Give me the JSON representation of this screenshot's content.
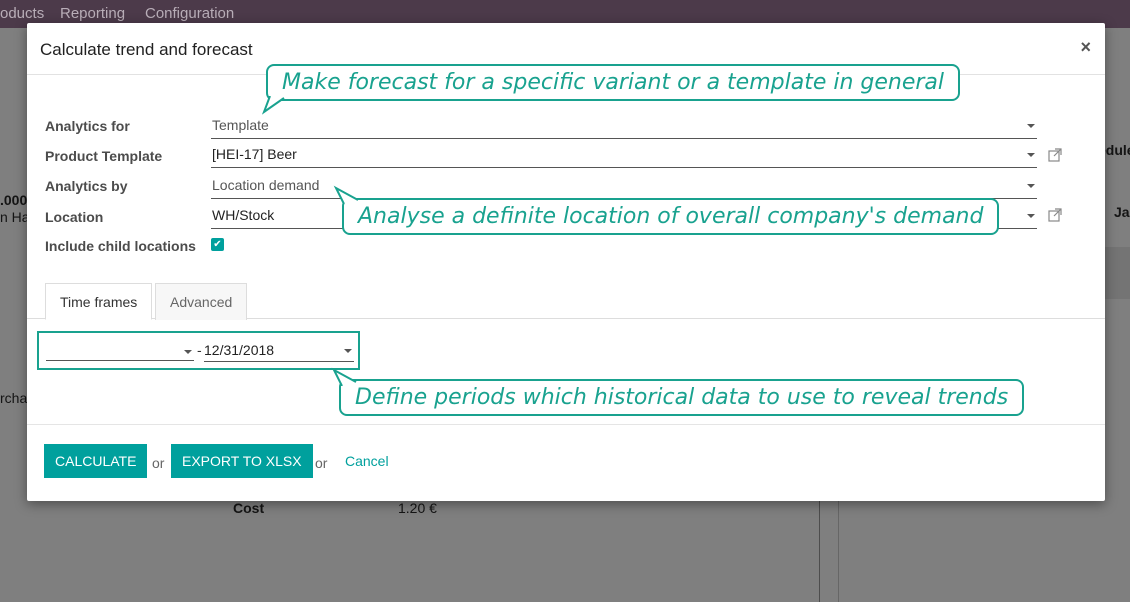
{
  "background": {
    "menu": [
      "oducts",
      "Reporting",
      "Configuration"
    ],
    "fragments": [
      ".000",
      "n Ha",
      "rcha",
      "edule",
      "Ja"
    ],
    "cost_label": "Cost",
    "cost_value": "1.20 €"
  },
  "modal": {
    "title": "Calculate trend and forecast",
    "close_symbol": "×"
  },
  "fields": {
    "analytics_for": {
      "label": "Analytics for",
      "value": "Template"
    },
    "product_template": {
      "label": "Product Template",
      "value": "[HEI-17] Beer"
    },
    "analytics_by": {
      "label": "Analytics by",
      "value": "Location demand"
    },
    "location": {
      "label": "Location",
      "value": "WH/Stock"
    },
    "include_child": {
      "label": "Include child locations",
      "checked": true
    }
  },
  "tabs": {
    "time_frames": "Time frames",
    "advanced": "Advanced"
  },
  "time_frame": {
    "from": "",
    "separator": "-",
    "to": "12/31/2018"
  },
  "footer": {
    "calculate": "CALCULATE",
    "or1": "or",
    "export": "EXPORT TO XLSX",
    "or2": "or",
    "cancel": "Cancel"
  },
  "callouts": {
    "variant_template": "Make forecast for a specific variant or a template in general",
    "location_demand": "Analyse a definite location of overall company's demand",
    "periods": "Define periods which historical data to use to reveal trends"
  },
  "colors": {
    "accent": "#00a09d",
    "callout": "#19a28f",
    "topbar": "#4c3a4a"
  }
}
